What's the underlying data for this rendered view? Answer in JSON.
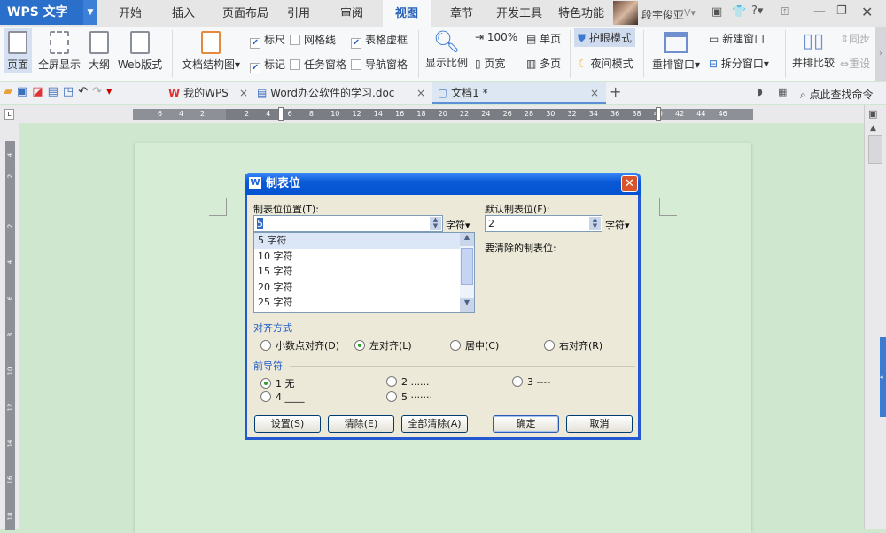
{
  "app": {
    "name": "WPS 文字"
  },
  "menu_tabs": [
    "开始",
    "插入",
    "页面布局",
    "引用",
    "审阅",
    "视图",
    "章节",
    "开发工具",
    "特色功能"
  ],
  "active_tab": "视图",
  "user": {
    "name": "段宇俊亚"
  },
  "window_controls": {
    "help": "?"
  },
  "ribbon": {
    "page": "页面",
    "fullscreen": "全屏显示",
    "outline": "大纲",
    "web": "Web版式",
    "docmap": "文档结构图",
    "ruler": "标尺",
    "gridlines": "网格线",
    "table_gridlines": "表格虚框",
    "marks": "标记",
    "task_pane": "任务窗格",
    "nav_pane": "导航窗格",
    "zoom": "显示比例",
    "zoom100": "100%",
    "page_width": "页宽",
    "single_page": "单页",
    "multi_page": "多页",
    "eye_mode": "护眼模式",
    "night_mode": "夜间模式",
    "arrange": "重排窗口",
    "new_window": "新建窗口",
    "split": "拆分窗口",
    "side_by_side": "并排比较",
    "sync": "同步",
    "reset": "重设"
  },
  "checkboxes": {
    "ruler": true,
    "gridlines": false,
    "table_gridlines": true,
    "marks": true,
    "task_pane": false,
    "nav_pane": false
  },
  "doc_tabs": [
    {
      "label": "我的WPS"
    },
    {
      "label": "Word办公软件的学习.doc"
    },
    {
      "label": "文档1 *"
    }
  ],
  "search_command": "点此查找命令",
  "ruler_h": [
    "6",
    "4",
    "2",
    "2",
    "4",
    "6",
    "8",
    "10",
    "12",
    "14",
    "16",
    "18",
    "20",
    "22",
    "24",
    "26",
    "28",
    "30",
    "32",
    "34",
    "36",
    "38",
    "40",
    "42",
    "44",
    "46"
  ],
  "ruler_v": [
    "4",
    "2",
    "2",
    "4",
    "6",
    "8",
    "10",
    "12",
    "14",
    "16",
    "18"
  ],
  "dialog": {
    "title": "制表位",
    "tab_pos_label": "制表位位置(T):",
    "tab_pos_value": "5",
    "unit": "字符",
    "default_label": "默认制表位(F):",
    "default_value": "2",
    "clear_label": "要清除的制表位:",
    "list": [
      "5 字符",
      "10 字符",
      "15 字符",
      "20 字符",
      "25 字符"
    ],
    "align_title": "对齐方式",
    "align": [
      {
        "label": "小数点对齐(D)",
        "checked": false
      },
      {
        "label": "左对齐(L)",
        "checked": true
      },
      {
        "label": "居中(C)",
        "checked": false
      },
      {
        "label": "右对齐(R)",
        "checked": false
      }
    ],
    "leader_title": "前导符",
    "leaders": [
      {
        "label": "1 无",
        "checked": true
      },
      {
        "label": "2 ......",
        "checked": false
      },
      {
        "label": "3 ----",
        "checked": false
      },
      {
        "label": "4 ____",
        "checked": false
      },
      {
        "label": "5 ·······",
        "checked": false
      }
    ],
    "buttons": {
      "set": "设置(S)",
      "clear": "清除(E)",
      "clear_all": "全部清除(A)",
      "ok": "确定",
      "cancel": "取消"
    }
  }
}
